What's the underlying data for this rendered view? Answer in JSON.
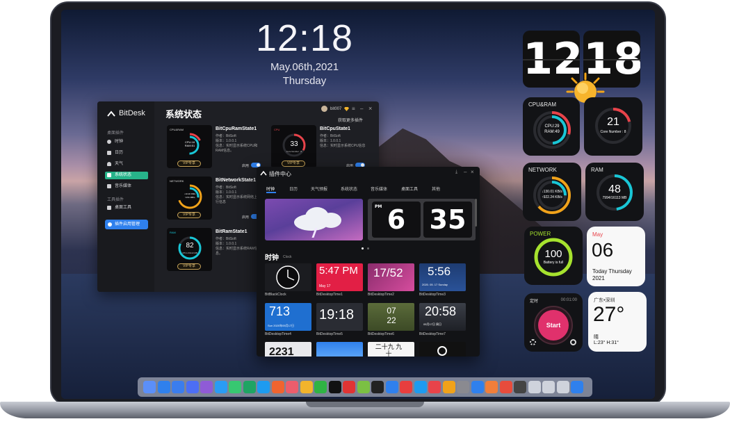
{
  "desktop": {
    "time": "12:18",
    "date": "May.06th,2021",
    "weekday": "Thursday"
  },
  "widgets": {
    "flip_hour": "12",
    "flip_minute": "18",
    "cpuram": {
      "title": "CPU&RAM",
      "cpu": "CPU:29",
      "ram": "RAM:49",
      "cpu_pct": 29,
      "ram_pct": 49
    },
    "cpu": {
      "value": "21",
      "label": "Core Number : 8",
      "pct": 21
    },
    "network": {
      "title": "NETWORK",
      "down": "↓130.01 KB/s",
      "up": "↑922.24 KB/s"
    },
    "ram": {
      "title": "RAM",
      "value": "48",
      "label": "7994/16113 MB",
      "pct": 48
    },
    "power": {
      "title": "POWER",
      "value": "100",
      "label": "Battery is full",
      "pct": 100
    },
    "calendar": {
      "month": "May",
      "day": "06",
      "line1": "Today Thursday",
      "line2": "2021"
    },
    "timer": {
      "title": "定时",
      "time": "00:01:00",
      "button": "Start"
    },
    "weather": {
      "city": "广东•深圳",
      "temp": "27°",
      "cond": "晴",
      "range": "L:23° H:31°"
    }
  },
  "bitdesk": {
    "app_name": "BitDesk",
    "page_title": "系统状态",
    "user": "bit007",
    "get_more": "获取更多插件",
    "sidebar": {
      "section1": "桌面插件",
      "items": [
        {
          "label": "时钟",
          "icon": "clock-icon"
        },
        {
          "label": "日历",
          "icon": "calendar-icon"
        },
        {
          "label": "天气",
          "icon": "weather-icon"
        },
        {
          "label": "系统状态",
          "icon": "monitor-icon"
        },
        {
          "label": "音乐媒体",
          "icon": "music-icon"
        }
      ],
      "section2": "工具插件",
      "tools": [
        {
          "label": "桌面工具",
          "icon": "grid-icon"
        }
      ],
      "manage": "插件启用管理"
    },
    "cards": [
      {
        "name": "BitCpuRamState1",
        "author": "作者：BitSoft",
        "version": "版本：1.0.0.1",
        "desc": "信息：实时显示系统CPU和RAM信息。",
        "vip": "VIP专享",
        "enable": "启用",
        "thumb_title": "CPU&RAM",
        "thumb_text1": "CPU:18",
        "thumb_text2": "RAM:51"
      },
      {
        "name": "BitCpuState1",
        "author": "作者：BitSoft",
        "version": "版本：1.0.0.1",
        "desc": "信息：实时显示系统CPU信息",
        "vip": "VIP专享",
        "enable": "启用",
        "thumb_title": "CPU",
        "thumb_text1": "33",
        "thumb_text2": "Core Number : 8"
      },
      {
        "name": "BitNetworkState1",
        "author": "作者：BitSoft",
        "version": "版本：1.0.0.1",
        "desc": "信息：实时显示系统网络上下行信息",
        "vip": "VIP专享",
        "enable": "启用",
        "thumb_title": "NETWORK",
        "thumb_text1": "↓10.16 KB/s",
        "thumb_text2": "↑4.51 MB/s"
      },
      {
        "name": "BitRamState1",
        "author": "作者：BitSoft",
        "version": "版本：1.0.0.1",
        "desc": "信息：实时显示系统RAM信息。",
        "vip": "VIP专享",
        "enable": "启用",
        "thumb_title": "RAM",
        "thumb_text1": "82",
        "thumb_text2": "375.1/16113 MB"
      }
    ]
  },
  "plugin_center": {
    "title": "插件中心",
    "tabs": [
      "时钟",
      "日历",
      "天气预报",
      "系统状态",
      "音乐媒体",
      "桌面工具",
      "其他"
    ],
    "banner_flip_label": "PM",
    "banner_flip_hour": "6",
    "banner_flip_minute": "35",
    "section_title": "时钟",
    "section_sub": "Clock",
    "tiles": [
      {
        "name": "BitBlackClock",
        "text": ""
      },
      {
        "name": "BitDesktopTime1",
        "text": "5:47 PM",
        "sub": "May 17"
      },
      {
        "name": "BitDesktopTime2",
        "text": "17/52",
        "sub": ""
      },
      {
        "name": "BitDesktopTime3",
        "text": "5:56",
        "sub": "2020. 05. 17 Sunday"
      },
      {
        "name": "BitDesktopTime4",
        "text": "713",
        "sub": "Sun 2020年05月17日"
      },
      {
        "name": "BitDesktopTime5",
        "text": "19:18",
        "sub": ""
      },
      {
        "name": "BitDesktopTime6",
        "text": "07 22",
        "sub": ""
      },
      {
        "name": "BitDesktopTime7",
        "text": "20:58",
        "sub": "05月17日 周日"
      }
    ],
    "row3": [
      {
        "text": "2231"
      },
      {
        "text": ""
      },
      {
        "text": "二十九 九十"
      },
      {
        "text": ""
      }
    ]
  },
  "colors": {
    "accent_green": "#27b38a",
    "accent_blue": "#2f80ed",
    "cpu_red": "#e8434a",
    "ring_cyan": "#19c6d6",
    "ring_orange": "#f0a21a",
    "power_green": "#a6e22e",
    "timer_pink": "#e0316c"
  }
}
